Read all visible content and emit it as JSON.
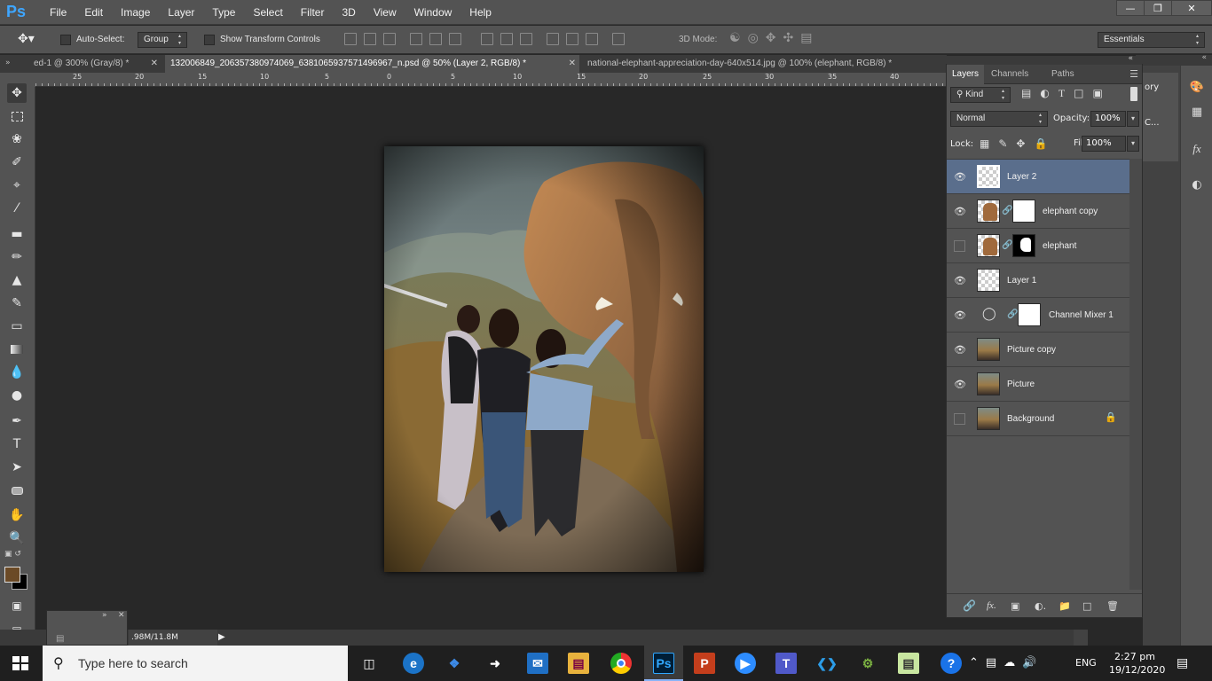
{
  "app": {
    "logo": "Ps"
  },
  "menu": [
    "File",
    "Edit",
    "Image",
    "Layer",
    "Type",
    "Select",
    "Filter",
    "3D",
    "View",
    "Window",
    "Help"
  ],
  "options_bar": {
    "auto_select_label": "Auto-Select:",
    "auto_select_value": "Group",
    "show_transform_label": "Show Transform Controls",
    "mode_3d_label": "3D Mode:",
    "workspace": "Essentials"
  },
  "tabs": [
    {
      "label": "ed-1 @ 300% (Gray/8) *",
      "active": false
    },
    {
      "label": "132006849_206357380974069_6381065937571496967_n.psd @ 50% (Layer 2, RGB/8) *",
      "active": true
    },
    {
      "label": "national-elephant-appreciation-day-640x514.jpg @ 100% (elephant, RGB/8) *",
      "active": false
    }
  ],
  "ruler": [
    "25",
    "20",
    "15",
    "10",
    "5",
    "0",
    "5",
    "10",
    "15",
    "20",
    "25",
    "30",
    "35",
    "40"
  ],
  "layers_panel": {
    "tabs": [
      "Layers",
      "Channels",
      "Paths"
    ],
    "filter_label": "Kind",
    "blend_mode": "Normal",
    "opacity_label": "Opacity:",
    "opacity": "100%",
    "lock_label": "Lock:",
    "fill_label": "Fill:",
    "fill": "100%",
    "layers": [
      {
        "name": "Layer 2",
        "visible": true,
        "selected": true,
        "thumb": "transparent"
      },
      {
        "name": "elephant copy",
        "visible": true,
        "selected": false,
        "thumb": "elephant",
        "mask": true
      },
      {
        "name": "elephant",
        "visible": false,
        "selected": false,
        "thumb": "elephant",
        "mask": true
      },
      {
        "name": "Layer 1",
        "visible": true,
        "selected": false,
        "thumb": "transparent"
      },
      {
        "name": "Channel Mixer 1",
        "visible": true,
        "selected": false,
        "thumb": "adjustment",
        "mask": true
      },
      {
        "name": "Picture copy",
        "visible": true,
        "selected": false,
        "thumb": "photo"
      },
      {
        "name": "Picture",
        "visible": true,
        "selected": false,
        "thumb": "photo"
      },
      {
        "name": "Background",
        "visible": false,
        "selected": false,
        "thumb": "photo",
        "locked": true
      }
    ]
  },
  "side_panel_partial": {
    "line1": "ory",
    "line2": "C..."
  },
  "status": {
    "doc_size": ".98M/11.8M"
  },
  "taskbar": {
    "search_placeholder": "Type here to search",
    "time": "2:27 pm",
    "date": "19/12/2020",
    "lang": "ENG"
  },
  "colors": {
    "foreground": "#6b4a26",
    "background": "#000000",
    "selection": "#5a6e8c"
  }
}
